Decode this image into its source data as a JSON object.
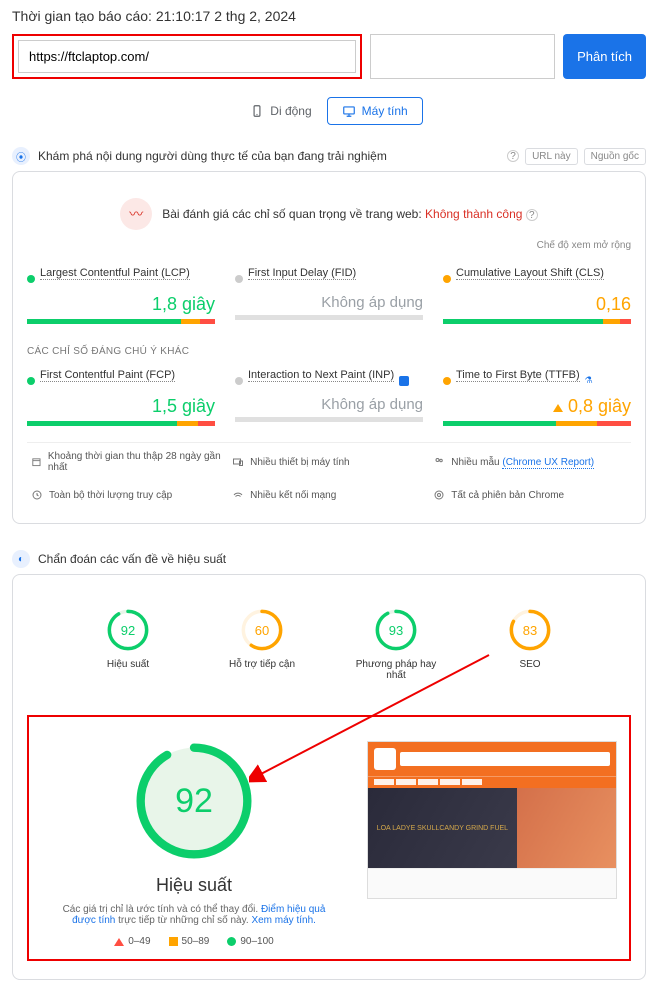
{
  "header": {
    "timestamp": "Thời gian tạo báo cáo: 21:10:17 2 thg 2, 2024"
  },
  "url_input": {
    "value": "https://ftclaptop.com/",
    "analyze_btn": "Phân tích"
  },
  "tabs": {
    "mobile": "Di động",
    "desktop": "Máy tính"
  },
  "discover": {
    "title": "Khám phá nội dung người dùng thực tế của bạn đang trải nghiệm",
    "url_pill": "URL này",
    "origin_pill": "Nguồn gốc"
  },
  "cwv": {
    "banner": "Bài đánh giá các chỉ số quan trọng về trang web:",
    "banner_fail": "Không thành công",
    "expand": "Chế độ xem mở rộng",
    "lcp": {
      "name": "Largest Contentful Paint (LCP)",
      "value": "1,8 giây"
    },
    "fid": {
      "name": "First Input Delay (FID)",
      "value": "Không áp dụng"
    },
    "cls": {
      "name": "Cumulative Layout Shift (CLS)",
      "value": "0,16"
    },
    "other_header": "CÁC CHỈ SỐ ĐÁNG CHÚ Ý KHÁC",
    "fcp": {
      "name": "First Contentful Paint (FCP)",
      "value": "1,5 giây"
    },
    "inp": {
      "name": "Interaction to Next Paint (INP)",
      "value": "Không áp dụng"
    },
    "ttfb": {
      "name": "Time to First Byte (TTFB)",
      "value": "0,8 giây"
    }
  },
  "info": {
    "period": "Khoảng thời gian thu thập 28 ngày gần nhất",
    "devices": "Nhiều thiết bị máy tính",
    "samples_pre": "Nhiều mẫu",
    "samples_link": "(Chrome UX Report)",
    "sessions": "Toàn bộ thời lượng truy cập",
    "connections": "Nhiều kết nối mạng",
    "versions": "Tất cả phiên bản Chrome"
  },
  "diagnose": {
    "title": "Chẩn đoán các vấn đề về hiệu suất"
  },
  "gauges": {
    "perf": {
      "score": "92",
      "label": "Hiệu suất"
    },
    "a11y": {
      "score": "60",
      "label": "Hỗ trợ tiếp cận"
    },
    "bp": {
      "score": "93",
      "label": "Phương pháp hay nhất"
    },
    "seo": {
      "score": "83",
      "label": "SEO"
    }
  },
  "hero": {
    "score": "92",
    "title": "Hiệu suất",
    "desc_pre": "Các giá trị chỉ là ước tính và có thể thay đổi.",
    "desc_link1": "Điểm hiệu quả được tính",
    "desc_mid": "trực tiếp từ những chỉ số này.",
    "desc_link2": "Xem máy tính.",
    "thumb_text": "LOA LADYE SKULLCANDY\nGRIND FUEL"
  },
  "legend": {
    "r": "0–49",
    "o": "50–89",
    "g": "90–100"
  }
}
